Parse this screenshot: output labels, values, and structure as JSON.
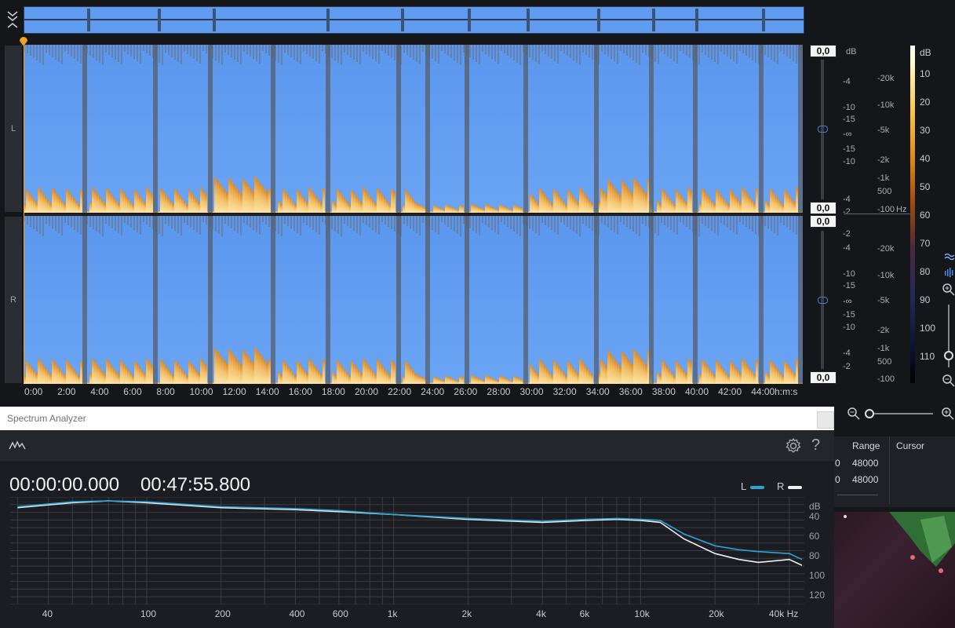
{
  "channels": {
    "left": "L",
    "right": "R"
  },
  "gain_values": {
    "l_top": "0,0",
    "l_bottom": "0,0",
    "r_top": "0,0",
    "r_bottom": "0,0"
  },
  "db_scale": {
    "header": "dB",
    "left": [
      "-4",
      "-10",
      "-15",
      "-∞",
      "-15",
      "-10",
      "-4",
      "-2"
    ],
    "right": [
      "-2",
      "-4",
      "-10",
      "-15",
      "-∞",
      "-15",
      "-10",
      "-4",
      "-2"
    ]
  },
  "hz_scale": {
    "left": [
      "-20k",
      "-10k",
      "-5k",
      "-2k",
      "-1k",
      "500",
      "-100"
    ],
    "right": [
      "-20k",
      "-10k",
      "-5k",
      "-2k",
      "-1k",
      "500",
      "-100"
    ],
    "unit": "Hz"
  },
  "colorbar": {
    "header": "dB",
    "ticks": [
      "10",
      "20",
      "30",
      "40",
      "50",
      "60",
      "70",
      "80",
      "90",
      "100",
      "110"
    ]
  },
  "timeline": {
    "ticks": [
      "0:00",
      "2:00",
      "4:00",
      "6:00",
      "8:00",
      "10:00",
      "12:00",
      "14:00",
      "16:00",
      "18:00",
      "20:00",
      "22:00",
      "24:00",
      "26:00",
      "28:00",
      "30:00",
      "32:00",
      "34:00",
      "36:00",
      "38:00",
      "40:00",
      "42:00",
      "44:00"
    ],
    "unit": "h:m:s"
  },
  "spectrum": {
    "title": "Spectrum Analyzer",
    "time_start": "00:00:00.000",
    "time_end": "00:47:55.800",
    "legend": [
      {
        "name": "L",
        "color": "#2aa3d6"
      },
      {
        "name": "R",
        "color": "#f0f0f0"
      }
    ],
    "y_unit": "dB",
    "y_ticks": [
      "40",
      "60",
      "80",
      "100",
      "120"
    ],
    "x_ticks": [
      "40",
      "100",
      "200",
      "400",
      "600",
      "1k",
      "2k",
      "4k",
      "6k",
      "10k",
      "20k",
      "40k Hz"
    ]
  },
  "chart_data": {
    "type": "line",
    "x": [
      30,
      50,
      70,
      100,
      200,
      400,
      600,
      1000,
      2000,
      4000,
      6000,
      8000,
      10000,
      12000,
      15000,
      20000,
      25000,
      30000,
      40000,
      45000
    ],
    "series": [
      {
        "name": "L",
        "values": [
          30,
          25,
          24,
          25,
          30,
          32,
          34,
          38,
          42,
          45,
          43,
          42,
          43,
          44,
          58,
          70,
          74,
          76,
          78,
          84
        ]
      },
      {
        "name": "R",
        "values": [
          31,
          26,
          24,
          26,
          31,
          33,
          35,
          38,
          43,
          46,
          44,
          43,
          44,
          46,
          63,
          78,
          84,
          87,
          84,
          90
        ]
      }
    ],
    "xlabel": "Hz",
    "ylabel": "dB",
    "ylim": [
      20,
      130
    ],
    "xscale": "log"
  },
  "right_panel": {
    "headers": [
      "Range",
      "Cursor"
    ],
    "rows": [
      [
        "0",
        "48000"
      ],
      [
        "0",
        "48000"
      ]
    ]
  }
}
